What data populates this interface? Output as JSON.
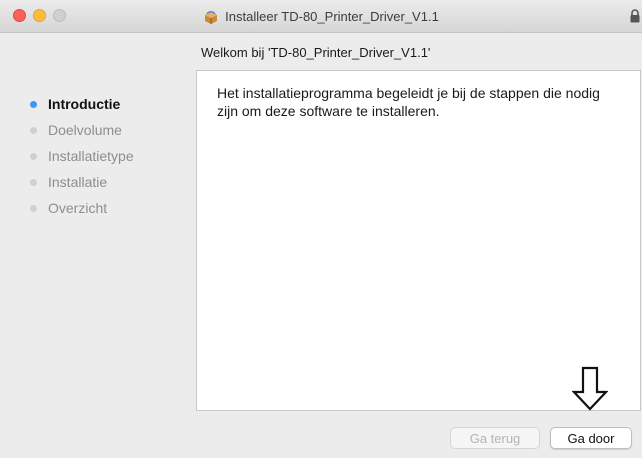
{
  "window": {
    "title": "Installeer TD-80_Printer_Driver_V1.1",
    "title_icon": "package-icon",
    "lock_icon": "lock-icon"
  },
  "content": {
    "heading": "Welkom bij 'TD-80_Printer_Driver_V1.1'",
    "body": "Het installatieprogramma begeleidt je bij de stappen die nodig zijn om deze software te installeren."
  },
  "sidebar": {
    "steps": [
      {
        "label": "Introductie",
        "active": true
      },
      {
        "label": "Doelvolume",
        "active": false
      },
      {
        "label": "Installatietype",
        "active": false
      },
      {
        "label": "Installatie",
        "active": false
      },
      {
        "label": "Overzicht",
        "active": false
      }
    ]
  },
  "buttons": {
    "back": "Ga terug",
    "next": "Ga door"
  },
  "colors": {
    "active_dot": "#3b99fc",
    "close": "#fc605b",
    "minimize": "#fdbc40"
  },
  "annotation": {
    "icon": "down-arrow-icon"
  }
}
